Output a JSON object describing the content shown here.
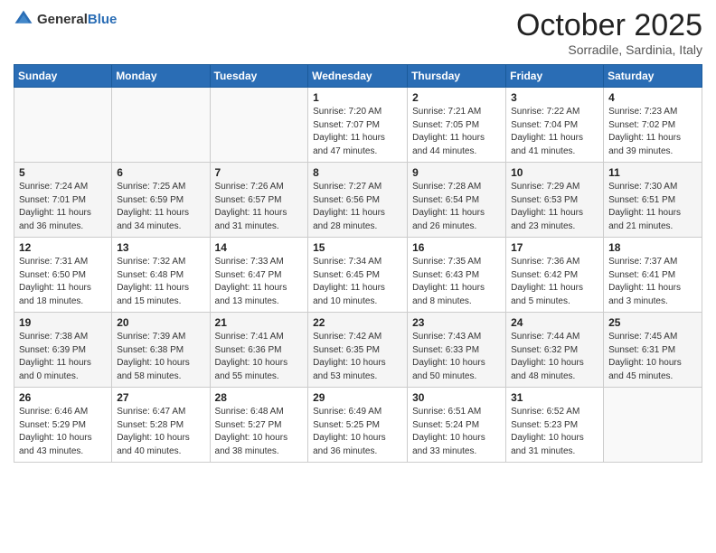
{
  "logo": {
    "general": "General",
    "blue": "Blue"
  },
  "header": {
    "month": "October 2025",
    "location": "Sorradile, Sardinia, Italy"
  },
  "weekdays": [
    "Sunday",
    "Monday",
    "Tuesday",
    "Wednesday",
    "Thursday",
    "Friday",
    "Saturday"
  ],
  "weeks": [
    [
      {
        "day": "",
        "info": ""
      },
      {
        "day": "",
        "info": ""
      },
      {
        "day": "",
        "info": ""
      },
      {
        "day": "1",
        "info": "Sunrise: 7:20 AM\nSunset: 7:07 PM\nDaylight: 11 hours\nand 47 minutes."
      },
      {
        "day": "2",
        "info": "Sunrise: 7:21 AM\nSunset: 7:05 PM\nDaylight: 11 hours\nand 44 minutes."
      },
      {
        "day": "3",
        "info": "Sunrise: 7:22 AM\nSunset: 7:04 PM\nDaylight: 11 hours\nand 41 minutes."
      },
      {
        "day": "4",
        "info": "Sunrise: 7:23 AM\nSunset: 7:02 PM\nDaylight: 11 hours\nand 39 minutes."
      }
    ],
    [
      {
        "day": "5",
        "info": "Sunrise: 7:24 AM\nSunset: 7:01 PM\nDaylight: 11 hours\nand 36 minutes."
      },
      {
        "day": "6",
        "info": "Sunrise: 7:25 AM\nSunset: 6:59 PM\nDaylight: 11 hours\nand 34 minutes."
      },
      {
        "day": "7",
        "info": "Sunrise: 7:26 AM\nSunset: 6:57 PM\nDaylight: 11 hours\nand 31 minutes."
      },
      {
        "day": "8",
        "info": "Sunrise: 7:27 AM\nSunset: 6:56 PM\nDaylight: 11 hours\nand 28 minutes."
      },
      {
        "day": "9",
        "info": "Sunrise: 7:28 AM\nSunset: 6:54 PM\nDaylight: 11 hours\nand 26 minutes."
      },
      {
        "day": "10",
        "info": "Sunrise: 7:29 AM\nSunset: 6:53 PM\nDaylight: 11 hours\nand 23 minutes."
      },
      {
        "day": "11",
        "info": "Sunrise: 7:30 AM\nSunset: 6:51 PM\nDaylight: 11 hours\nand 21 minutes."
      }
    ],
    [
      {
        "day": "12",
        "info": "Sunrise: 7:31 AM\nSunset: 6:50 PM\nDaylight: 11 hours\nand 18 minutes."
      },
      {
        "day": "13",
        "info": "Sunrise: 7:32 AM\nSunset: 6:48 PM\nDaylight: 11 hours\nand 15 minutes."
      },
      {
        "day": "14",
        "info": "Sunrise: 7:33 AM\nSunset: 6:47 PM\nDaylight: 11 hours\nand 13 minutes."
      },
      {
        "day": "15",
        "info": "Sunrise: 7:34 AM\nSunset: 6:45 PM\nDaylight: 11 hours\nand 10 minutes."
      },
      {
        "day": "16",
        "info": "Sunrise: 7:35 AM\nSunset: 6:43 PM\nDaylight: 11 hours\nand 8 minutes."
      },
      {
        "day": "17",
        "info": "Sunrise: 7:36 AM\nSunset: 6:42 PM\nDaylight: 11 hours\nand 5 minutes."
      },
      {
        "day": "18",
        "info": "Sunrise: 7:37 AM\nSunset: 6:41 PM\nDaylight: 11 hours\nand 3 minutes."
      }
    ],
    [
      {
        "day": "19",
        "info": "Sunrise: 7:38 AM\nSunset: 6:39 PM\nDaylight: 11 hours\nand 0 minutes."
      },
      {
        "day": "20",
        "info": "Sunrise: 7:39 AM\nSunset: 6:38 PM\nDaylight: 10 hours\nand 58 minutes."
      },
      {
        "day": "21",
        "info": "Sunrise: 7:41 AM\nSunset: 6:36 PM\nDaylight: 10 hours\nand 55 minutes."
      },
      {
        "day": "22",
        "info": "Sunrise: 7:42 AM\nSunset: 6:35 PM\nDaylight: 10 hours\nand 53 minutes."
      },
      {
        "day": "23",
        "info": "Sunrise: 7:43 AM\nSunset: 6:33 PM\nDaylight: 10 hours\nand 50 minutes."
      },
      {
        "day": "24",
        "info": "Sunrise: 7:44 AM\nSunset: 6:32 PM\nDaylight: 10 hours\nand 48 minutes."
      },
      {
        "day": "25",
        "info": "Sunrise: 7:45 AM\nSunset: 6:31 PM\nDaylight: 10 hours\nand 45 minutes."
      }
    ],
    [
      {
        "day": "26",
        "info": "Sunrise: 6:46 AM\nSunset: 5:29 PM\nDaylight: 10 hours\nand 43 minutes."
      },
      {
        "day": "27",
        "info": "Sunrise: 6:47 AM\nSunset: 5:28 PM\nDaylight: 10 hours\nand 40 minutes."
      },
      {
        "day": "28",
        "info": "Sunrise: 6:48 AM\nSunset: 5:27 PM\nDaylight: 10 hours\nand 38 minutes."
      },
      {
        "day": "29",
        "info": "Sunrise: 6:49 AM\nSunset: 5:25 PM\nDaylight: 10 hours\nand 36 minutes."
      },
      {
        "day": "30",
        "info": "Sunrise: 6:51 AM\nSunset: 5:24 PM\nDaylight: 10 hours\nand 33 minutes."
      },
      {
        "day": "31",
        "info": "Sunrise: 6:52 AM\nSunset: 5:23 PM\nDaylight: 10 hours\nand 31 minutes."
      },
      {
        "day": "",
        "info": ""
      }
    ]
  ]
}
